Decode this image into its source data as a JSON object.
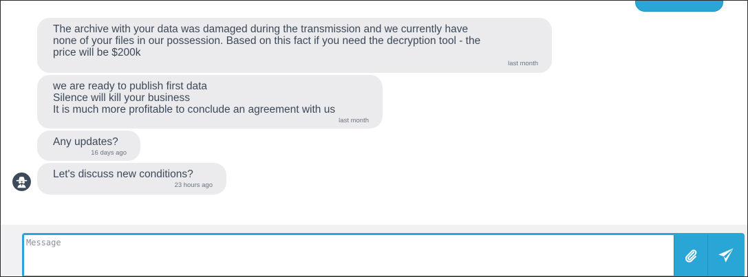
{
  "chat": {
    "messages": [
      {
        "text": "The archive with your data was damaged during the transmission and we currently have\nnone of your files in our possession. Based on this fact if you need the decryption tool - the\nprice will be $200k",
        "time": "last month"
      },
      {
        "text": "we are ready to publish first data\nSilence will kill your business\nIt is much more profitable to conclude an agreement with us",
        "time": "last month"
      },
      {
        "text": "Any updates?",
        "time": "16 days ago"
      },
      {
        "text": "Let's discuss new conditions?",
        "time": "23 hours ago"
      }
    ],
    "avatar_icon": "spy-icon"
  },
  "composer": {
    "placeholder": "Message",
    "attach_icon": "paperclip-icon",
    "send_icon": "paper-plane-icon"
  },
  "colors": {
    "accent": "#2aa6d6",
    "bubble": "#ebebed",
    "text": "#3c4858",
    "avatar": "#3e4a5c"
  }
}
